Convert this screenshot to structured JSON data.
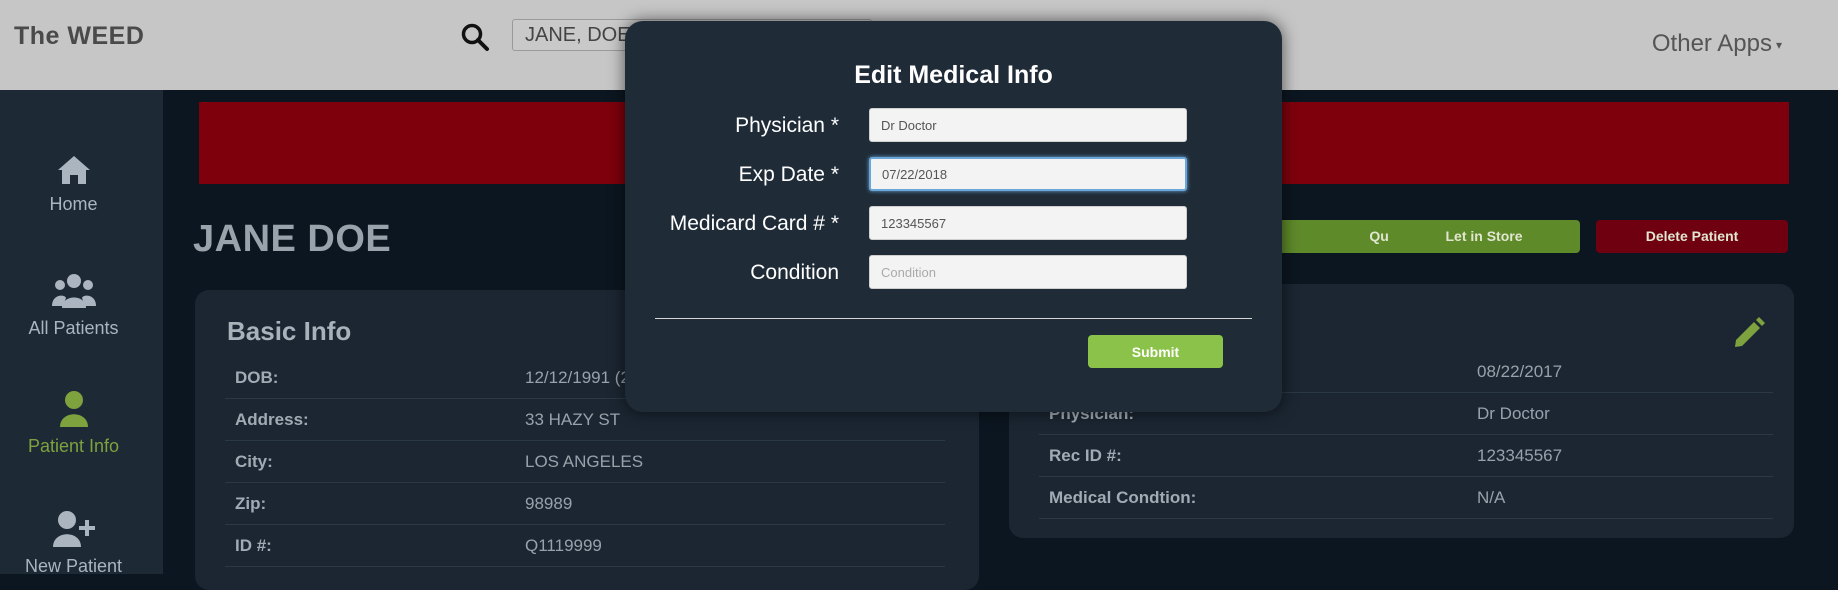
{
  "header": {
    "brand": "The WEED",
    "search_value": "JANE, DOE",
    "other_apps": "Other Apps"
  },
  "sidebar": {
    "items": [
      {
        "label": "Home",
        "icon": "home-icon"
      },
      {
        "label": "All Patients",
        "icon": "users-icon"
      },
      {
        "label": "Patient Info",
        "icon": "user-icon",
        "active": true
      },
      {
        "label": "New Patient",
        "icon": "user-plus-icon"
      }
    ]
  },
  "patient": {
    "name": "JANE DOE"
  },
  "actions": {
    "queue": "Queue",
    "let_in_store": "Let in Store",
    "delete_patient": "Delete Patient"
  },
  "basic_info": {
    "title": "Basic Info",
    "rows": [
      {
        "label": "DOB:",
        "value": "12/12/1991 (2"
      },
      {
        "label": "Address:",
        "value": "33 HAZY ST"
      },
      {
        "label": "City:",
        "value": "LOS ANGELES"
      },
      {
        "label": "Zip:",
        "value": "98989"
      },
      {
        "label": "ID #:",
        "value": "Q1119999"
      }
    ]
  },
  "medical_info": {
    "rows": [
      {
        "label": "",
        "value": "08/22/2017"
      },
      {
        "label": "Physician:",
        "value": "Dr Doctor"
      },
      {
        "label": "Rec ID #:",
        "value": "123345567"
      },
      {
        "label": "Medical Condtion:",
        "value": "N/A"
      }
    ]
  },
  "modal": {
    "title": "Edit Medical Info",
    "fields": {
      "physician": {
        "label": "Physician *",
        "value": "Dr Doctor"
      },
      "exp_date": {
        "label": "Exp Date *",
        "value": "07/22/2018"
      },
      "card": {
        "label": "Medicard Card # *",
        "value": "123345567"
      },
      "condition": {
        "label": "Condition",
        "placeholder": "Condition"
      }
    },
    "submit": "Submit"
  },
  "colors": {
    "accent_green": "#8bc34a",
    "danger_red": "#7e000c",
    "active_nav": "#7da23e"
  }
}
